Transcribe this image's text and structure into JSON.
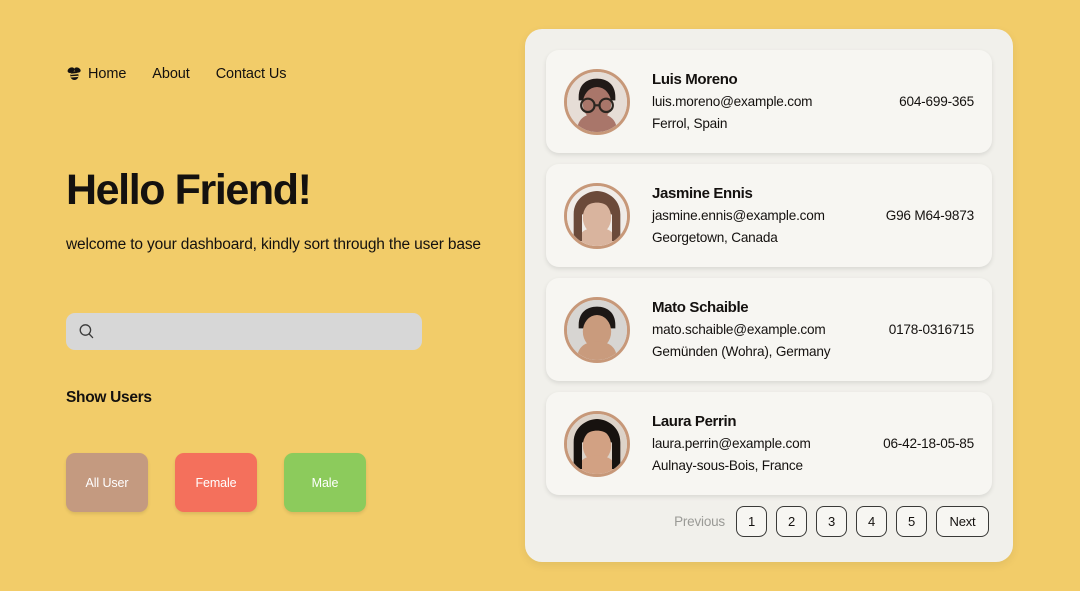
{
  "theme": {
    "background": "#F2CC69",
    "panel_bg": "#F1F0EB",
    "card_bg": "#F7F6F2",
    "text": "#14110F",
    "avatar_ring": "#C79879"
  },
  "nav": {
    "logo_icon": "bee-icon",
    "links": [
      {
        "label": "Home"
      },
      {
        "label": "About"
      },
      {
        "label": "Contact Us"
      }
    ]
  },
  "hero": {
    "title": "Hello Friend!",
    "subtitle": "welcome to your dashboard, kindly sort through the user base"
  },
  "search": {
    "icon": "search-icon",
    "value": "",
    "placeholder": ""
  },
  "filters": {
    "label": "Show Users",
    "buttons": [
      {
        "label": "All User",
        "color": "#C49A80",
        "key": "all"
      },
      {
        "label": "Female",
        "color": "#F4705C",
        "key": "female"
      },
      {
        "label": "Male",
        "color": "#8CCB5C",
        "key": "male"
      }
    ]
  },
  "users": [
    {
      "name": "Luis Moreno",
      "email": "luis.moreno@example.com",
      "location": "Ferrol, Spain",
      "phone": "604-699-365",
      "avatar": {
        "skin": "#a9766a",
        "hair": "#211a18",
        "bg": "#e6ddd6",
        "glasses": true,
        "long_hair": false
      }
    },
    {
      "name": "Jasmine Ennis",
      "email": "jasmine.ennis@example.com",
      "location": "Georgetown, Canada",
      "phone": "G96 M64-9873",
      "avatar": {
        "skin": "#d9b49e",
        "hair": "#6b4a3a",
        "bg": "#f0ece8",
        "glasses": false,
        "long_hair": true
      }
    },
    {
      "name": "Mato Schaible",
      "email": "mato.schaible@example.com",
      "location": "Gemünden (Wohra), Germany",
      "phone": "0178-0316715",
      "avatar": {
        "skin": "#c99b7d",
        "hair": "#1c1715",
        "bg": "#d7d5d2",
        "glasses": false,
        "long_hair": false
      }
    },
    {
      "name": "Laura Perrin",
      "email": "laura.perrin@example.com",
      "location": "Aulnay-sous-Bois, France",
      "phone": "06-42-18-05-85",
      "avatar": {
        "skin": "#d2a183",
        "hair": "#17120f",
        "bg": "#ddd3c9",
        "glasses": false,
        "long_hair": true
      }
    }
  ],
  "pagination": {
    "previous_label": "Previous",
    "next_label": "Next",
    "pages": [
      "1",
      "2",
      "3",
      "4",
      "5"
    ]
  }
}
